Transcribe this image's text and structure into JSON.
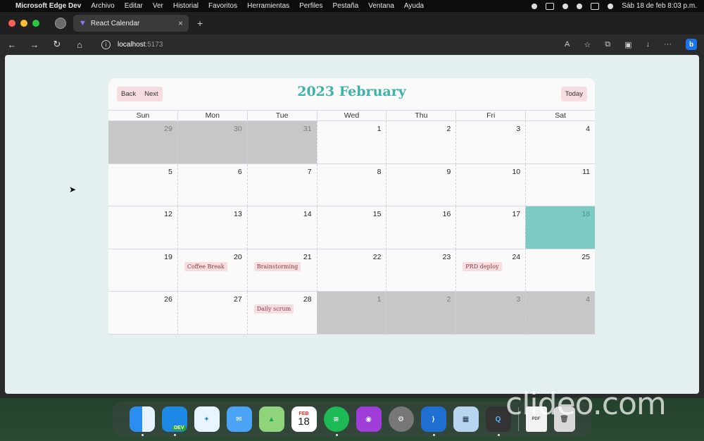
{
  "menubar": {
    "apple": "",
    "app_name": "Microsoft Edge Dev",
    "items": [
      "Archivo",
      "Editar",
      "Ver",
      "Historial",
      "Favoritos",
      "Herramientas",
      "Perfiles",
      "Pestaña",
      "Ventana",
      "Ayuda"
    ],
    "clock": "Sáb 18 de feb  8:03 p.m."
  },
  "browser": {
    "tab_title": "React Calendar",
    "tab_close": "×",
    "new_tab": "+",
    "url_host": "localhost",
    "url_port": ":5173",
    "nav_back": "←",
    "nav_forward": "→",
    "nav_reload": "↻",
    "nav_home": "⌂",
    "more": "···"
  },
  "calendar": {
    "title": "2023 February",
    "back_label": "Back",
    "next_label": "Next",
    "today_label": "Today",
    "weekdays": [
      "Sun",
      "Mon",
      "Tue",
      "Wed",
      "Thu",
      "Fri",
      "Sat"
    ],
    "weeks": [
      [
        {
          "d": "29",
          "off": true
        },
        {
          "d": "30",
          "off": true
        },
        {
          "d": "31",
          "off": true
        },
        {
          "d": "1"
        },
        {
          "d": "2"
        },
        {
          "d": "3"
        },
        {
          "d": "4"
        }
      ],
      [
        {
          "d": "5"
        },
        {
          "d": "6"
        },
        {
          "d": "7"
        },
        {
          "d": "8"
        },
        {
          "d": "9"
        },
        {
          "d": "10"
        },
        {
          "d": "11"
        }
      ],
      [
        {
          "d": "12"
        },
        {
          "d": "13"
        },
        {
          "d": "14"
        },
        {
          "d": "15"
        },
        {
          "d": "16"
        },
        {
          "d": "17"
        },
        {
          "d": "18",
          "today": true
        }
      ],
      [
        {
          "d": "19"
        },
        {
          "d": "20",
          "event": "Coffee Break"
        },
        {
          "d": "21",
          "event": "Brainstorming"
        },
        {
          "d": "22"
        },
        {
          "d": "23"
        },
        {
          "d": "24",
          "event": "PRD deploy"
        },
        {
          "d": "25"
        }
      ],
      [
        {
          "d": "26"
        },
        {
          "d": "27"
        },
        {
          "d": "28",
          "event": "Daily scrum"
        },
        {
          "d": "1",
          "off": true
        },
        {
          "d": "2",
          "off": true
        },
        {
          "d": "3",
          "off": true
        },
        {
          "d": "4",
          "off": true
        }
      ]
    ],
    "colors": {
      "accent": "#3fb1aa",
      "today_bg": "#7ccbc3",
      "off_bg": "#c7c7c7",
      "event_bg": "#f5dde0"
    }
  },
  "dock": {
    "edge_badge": "DEV",
    "calendar_month": "FEB",
    "calendar_day": "18",
    "pdf_label": "PDF"
  },
  "watermark": "clideo.com"
}
